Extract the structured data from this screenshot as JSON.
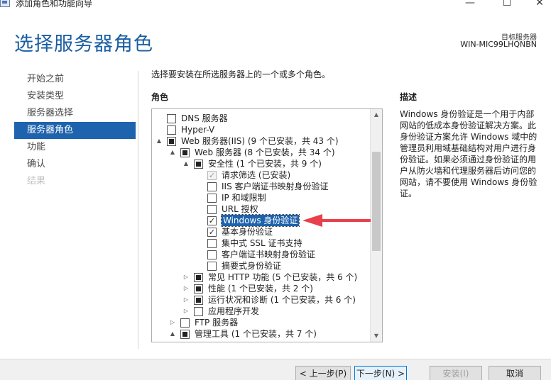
{
  "window": {
    "title": "添加角色和功能向导",
    "min_glyph": "—",
    "max_glyph": "☐",
    "close_glyph": "✕"
  },
  "header": {
    "page_title": "选择服务器角色",
    "target_label": "目标服务器",
    "target_value": "WIN-MIC99LHQNBN"
  },
  "nav": {
    "items": [
      {
        "label": "开始之前",
        "state": "normal"
      },
      {
        "label": "安装类型",
        "state": "normal"
      },
      {
        "label": "服务器选择",
        "state": "normal"
      },
      {
        "label": "服务器角色",
        "state": "active"
      },
      {
        "label": "功能",
        "state": "normal"
      },
      {
        "label": "确认",
        "state": "normal"
      },
      {
        "label": "结果",
        "state": "disabled"
      }
    ]
  },
  "main": {
    "instruction": "选择要安装在所选服务器上的一个或多个角色。",
    "roles_heading": "角色",
    "description_heading": "描述",
    "description_text": "Windows 身份验证是一个用于内部网站的低成本身份验证解决方案。此身份验证方案允许 Windows 域中的管理员利用域基础结构对用户进行身份验证。如果必须通过身份验证的用户从防火墙和代理服务器后访问您的网站，请不要使用 Windows 身份验证。"
  },
  "tree": {
    "rows": [
      {
        "level": 0,
        "expander": "",
        "check": "unchecked",
        "label": "DNS 服务器"
      },
      {
        "level": 0,
        "expander": "",
        "check": "unchecked",
        "label": "Hyper-V"
      },
      {
        "level": 0,
        "expander": "▲",
        "check": "indeterminate",
        "label": "Web 服务器(IIS) (9 个已安装，共 43 个)"
      },
      {
        "level": 1,
        "expander": "▲",
        "check": "indeterminate",
        "label": "Web 服务器 (8 个已安装，共 34 个)"
      },
      {
        "level": 2,
        "expander": "▲",
        "check": "indeterminate",
        "label": "安全性 (1 个已安装，共 9 个)"
      },
      {
        "level": 3,
        "expander": "",
        "check": "checked-disabled",
        "label": "请求筛选 (已安装)"
      },
      {
        "level": 3,
        "expander": "",
        "check": "unchecked",
        "label": "IIS 客户端证书映射身份验证"
      },
      {
        "level": 3,
        "expander": "",
        "check": "unchecked",
        "label": "IP 和域限制"
      },
      {
        "level": 3,
        "expander": "",
        "check": "unchecked",
        "label": "URL 授权"
      },
      {
        "level": 3,
        "expander": "",
        "check": "checked",
        "label": "Windows 身份验证",
        "selected": true
      },
      {
        "level": 3,
        "expander": "",
        "check": "checked",
        "label": "基本身份验证"
      },
      {
        "level": 3,
        "expander": "",
        "check": "unchecked",
        "label": "集中式 SSL 证书支持"
      },
      {
        "level": 3,
        "expander": "",
        "check": "unchecked",
        "label": "客户端证书映射身份验证"
      },
      {
        "level": 3,
        "expander": "",
        "check": "unchecked",
        "label": "摘要式身份验证"
      },
      {
        "level": 2,
        "expander": "▷",
        "check": "indeterminate",
        "label": "常见 HTTP 功能 (5 个已安装，共 6 个)"
      },
      {
        "level": 2,
        "expander": "▷",
        "check": "indeterminate",
        "label": "性能 (1 个已安装，共 2 个)"
      },
      {
        "level": 2,
        "expander": "▷",
        "check": "indeterminate",
        "label": "运行状况和诊断 (1 个已安装，共 6 个)"
      },
      {
        "level": 2,
        "expander": "▷",
        "check": "unchecked",
        "label": "应用程序开发"
      },
      {
        "level": 1,
        "expander": "▷",
        "check": "unchecked",
        "label": "FTP 服务器"
      },
      {
        "level": 1,
        "expander": "▲",
        "check": "indeterminate",
        "label": "管理工具 (1 个已安装，共 7 个)"
      }
    ]
  },
  "scroll": {
    "up_glyph": "▲",
    "down_glyph": "▼"
  },
  "buttons": {
    "prev": "< 上一步(P)",
    "next": "下一步(N) >",
    "install": "安装(I)",
    "cancel": "取消"
  },
  "colors": {
    "accent": "#1e63ad",
    "title_blue": "#1a5ea3",
    "annotation_arrow": "#e8404c"
  }
}
